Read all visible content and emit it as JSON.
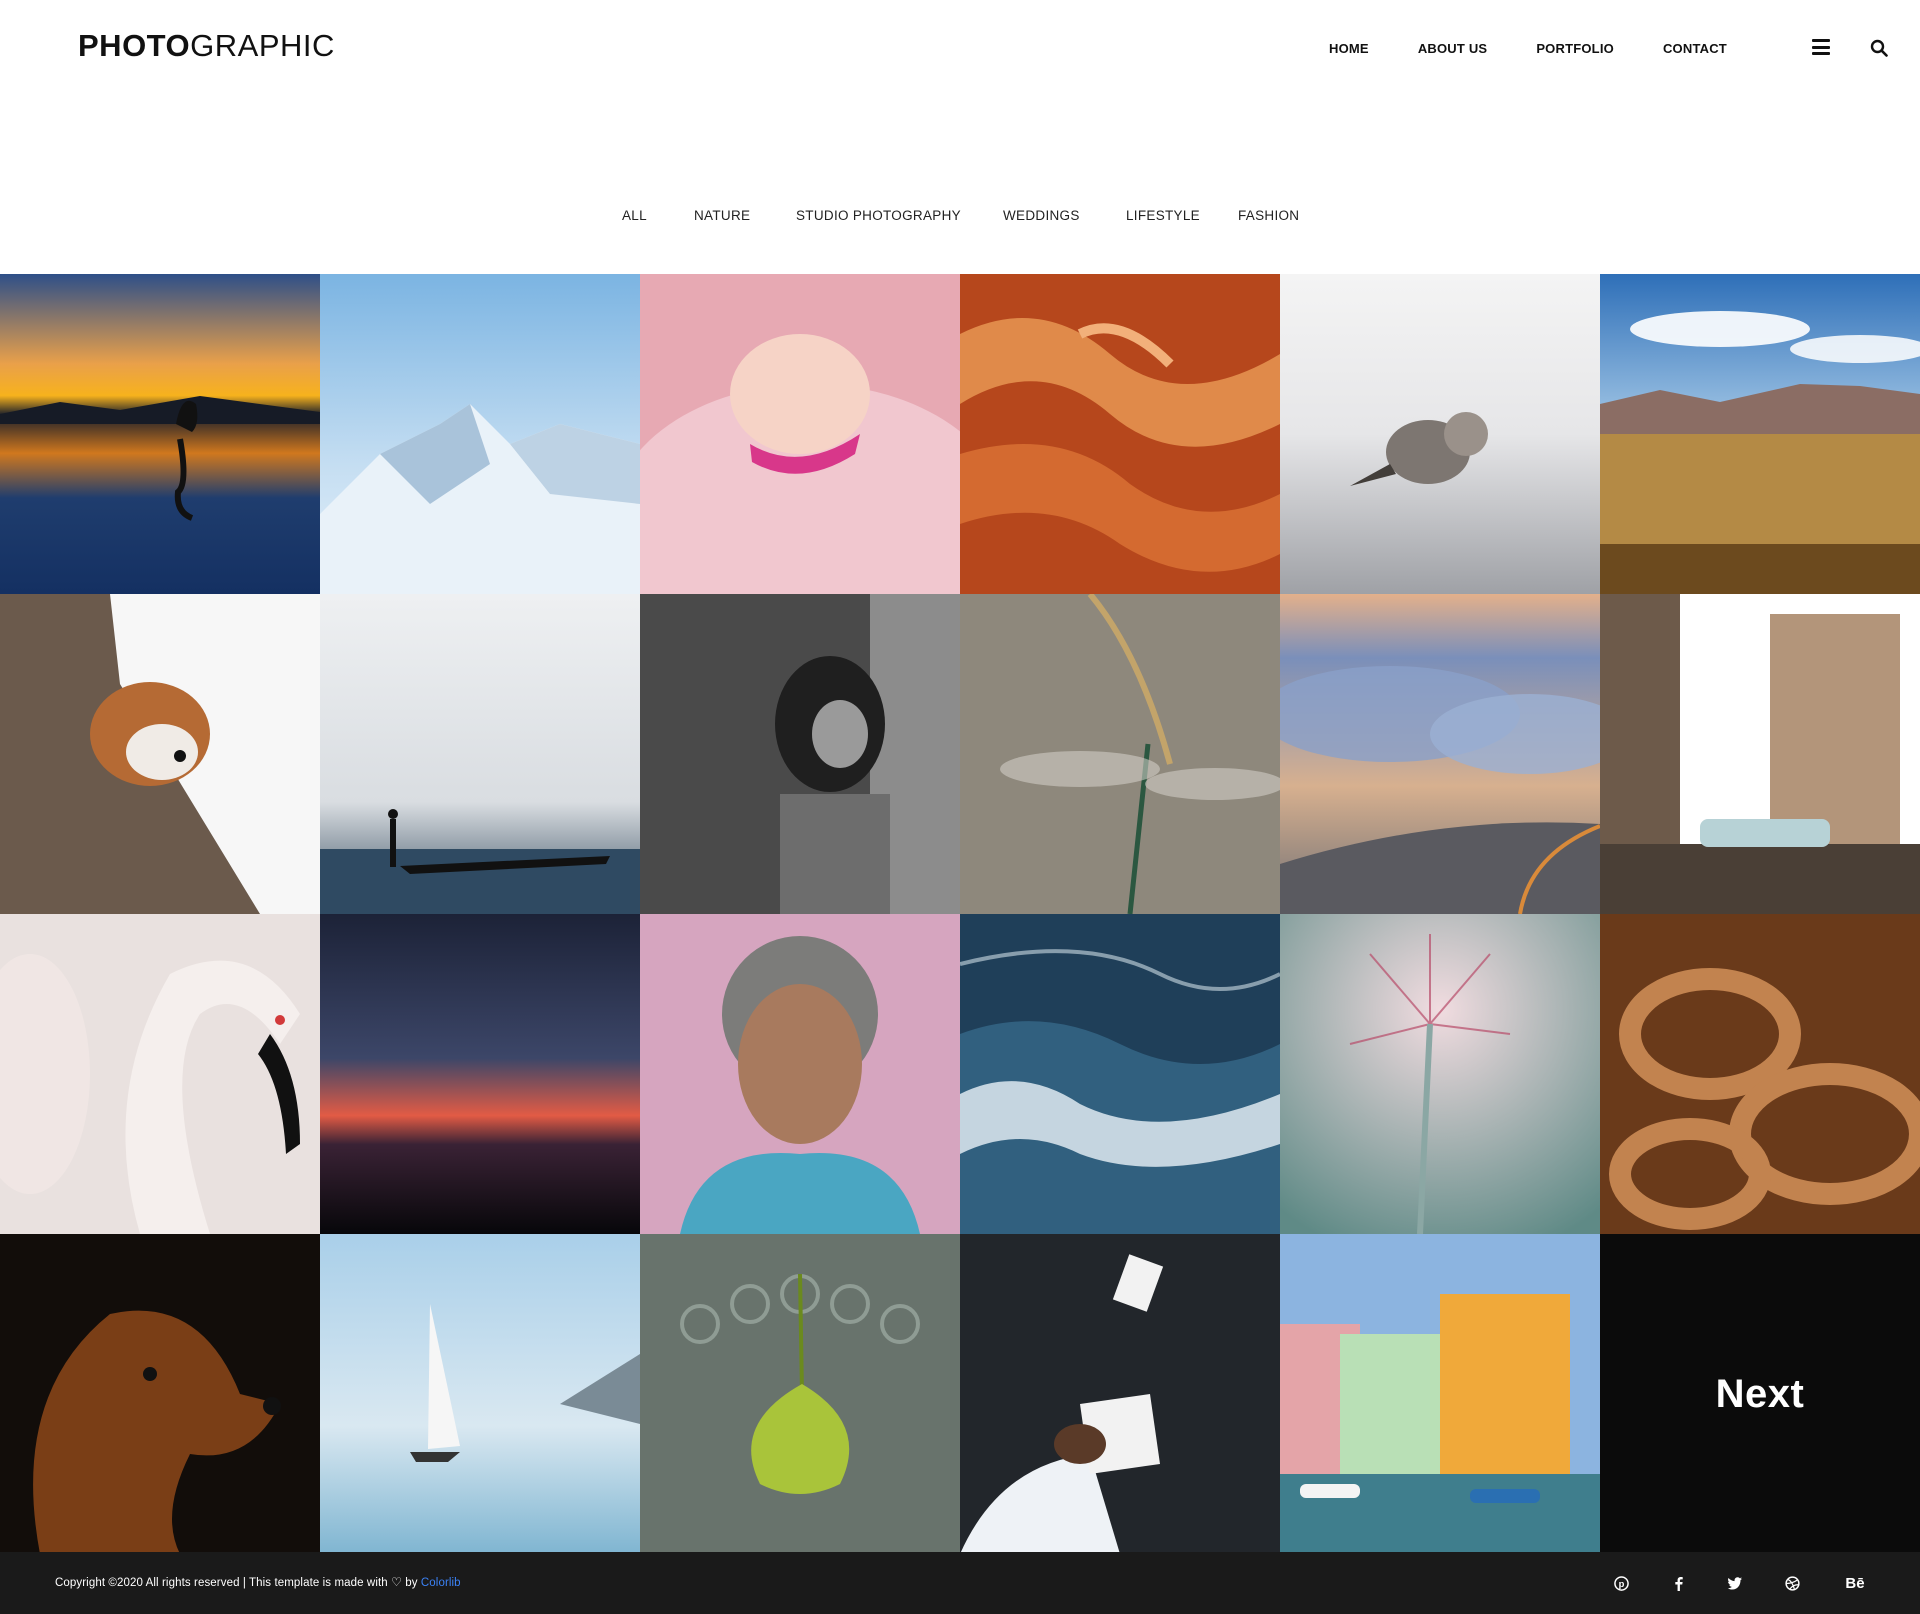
{
  "header": {
    "logo_bold": "PHOTO",
    "logo_light": "GRAPHIC",
    "nav": [
      "HOME",
      "ABOUT US",
      "PORTFOLIO",
      "CONTACT"
    ]
  },
  "filters": [
    "ALL",
    "NATURE",
    "STUDIO PHOTOGRAPHY",
    "WEDDINGS",
    "LIFESTYLE",
    "FASHION"
  ],
  "gallery": {
    "next_label": "Next"
  },
  "footer": {
    "copyright_pre": "Copyright ©2020 All rights reserved | This template is made with",
    "copyright_by": "by",
    "copyright_link": "Colorlib",
    "link_color": "#3b82f6",
    "socials": [
      "pinterest",
      "facebook",
      "twitter",
      "dribbble",
      "behance"
    ]
  }
}
